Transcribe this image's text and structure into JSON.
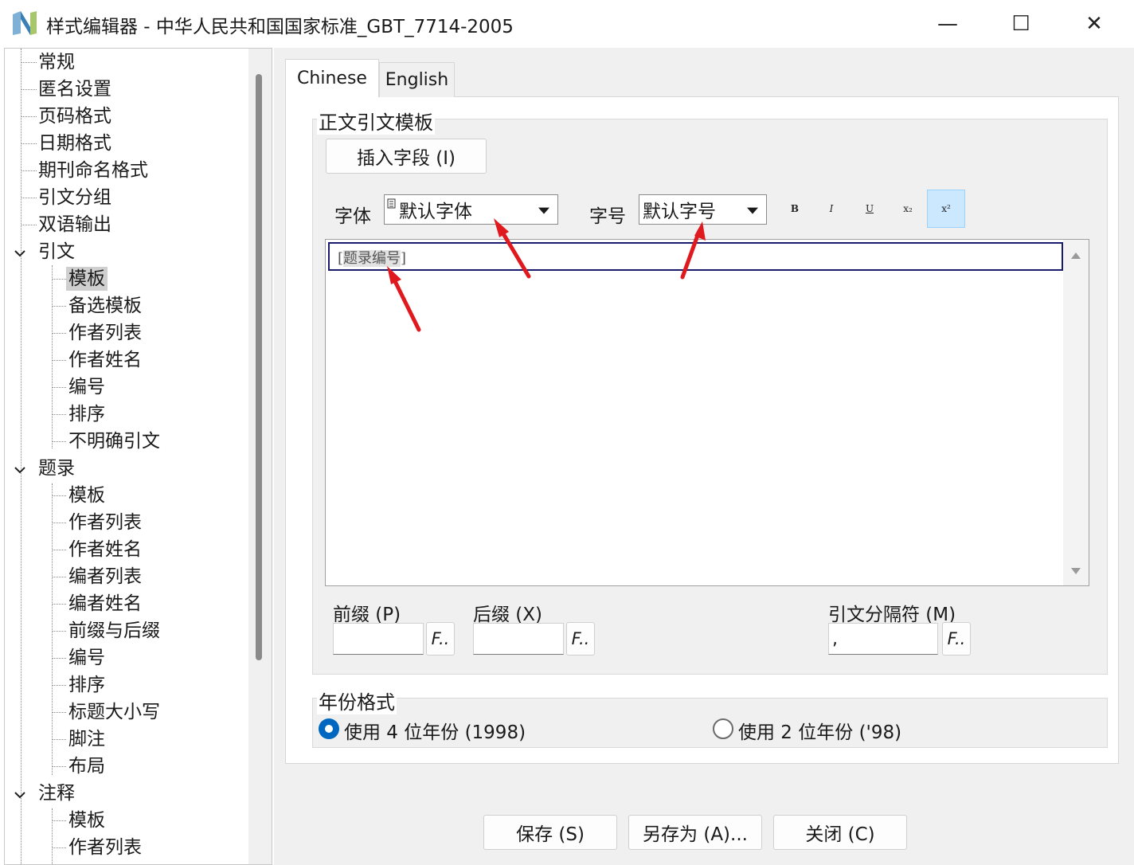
{
  "window": {
    "title": "样式编辑器 - 中华人民共和国国家标准_GBT_7714-2005",
    "minimize_glyph": "—",
    "maximize_glyph": "☐",
    "close_glyph": "✕"
  },
  "tree": {
    "items": [
      {
        "label": "常规"
      },
      {
        "label": "匿名设置"
      },
      {
        "label": "页码格式"
      },
      {
        "label": "日期格式"
      },
      {
        "label": "期刊命名格式"
      },
      {
        "label": "引文分组"
      },
      {
        "label": "双语输出"
      },
      {
        "label": "引文"
      },
      {
        "label": "模板"
      },
      {
        "label": "备选模板"
      },
      {
        "label": "作者列表"
      },
      {
        "label": "作者姓名"
      },
      {
        "label": "编号"
      },
      {
        "label": "排序"
      },
      {
        "label": "不明确引文"
      },
      {
        "label": "题录"
      },
      {
        "label": "模板"
      },
      {
        "label": "作者列表"
      },
      {
        "label": "作者姓名"
      },
      {
        "label": "编者列表"
      },
      {
        "label": "编者姓名"
      },
      {
        "label": "前缀与后缀"
      },
      {
        "label": "编号"
      },
      {
        "label": "排序"
      },
      {
        "label": "标题大小写"
      },
      {
        "label": "脚注"
      },
      {
        "label": "布局"
      },
      {
        "label": "注释"
      },
      {
        "label": "模板"
      },
      {
        "label": "作者列表"
      }
    ]
  },
  "tabs": [
    {
      "label": "Chinese"
    },
    {
      "label": "English"
    }
  ],
  "template_group": {
    "title": "正文引文模板",
    "insert_field_button": "插入字段 (I)",
    "font_label": "字体",
    "font_value": "默认字体",
    "size_label": "字号",
    "size_value": "默认字号",
    "format_buttons": {
      "bold": "B",
      "italic": "I",
      "underline": "U",
      "subscript": "x₂",
      "superscript": "x²"
    },
    "editor": {
      "open_bracket": "[",
      "field": "题录编号",
      "close_bracket": "]"
    },
    "prefix_label": "前缀 (P)",
    "prefix_value": "",
    "suffix_label": "后缀 (X)",
    "suffix_value": "",
    "separator_label": "引文分隔符 (M)",
    "separator_value": ",",
    "fx_label": "F.."
  },
  "year_group": {
    "title": "年份格式",
    "option_4": "使用 4 位年份 (1998)",
    "option_2": "使用 2 位年份 ('98)"
  },
  "footer": {
    "save": "保存 (S)",
    "save_as": "另存为 (A)...",
    "close": "关闭 (C)"
  },
  "colors": {
    "accent": "#0067c0",
    "annotation_arrow": "#e0191f",
    "active_button": "#cce8ff"
  }
}
